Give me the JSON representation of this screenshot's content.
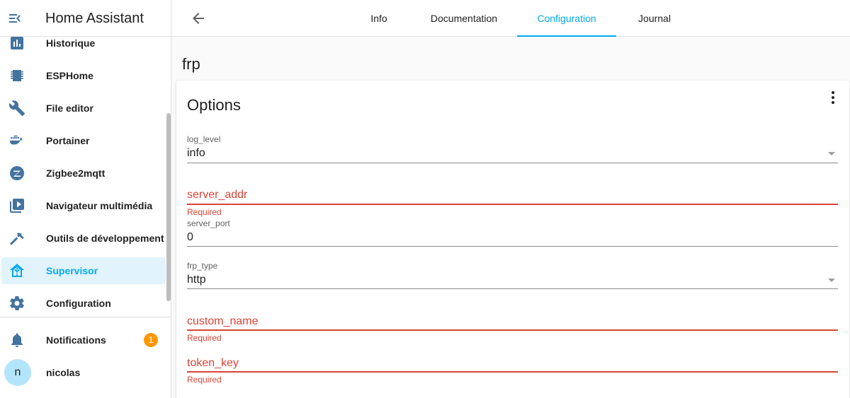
{
  "app": {
    "title": "Home Assistant"
  },
  "sidebar": {
    "items": [
      {
        "label": "Historique",
        "icon": "chart-bar-icon"
      },
      {
        "label": "ESPHome",
        "icon": "chip-icon"
      },
      {
        "label": "File editor",
        "icon": "wrench-icon"
      },
      {
        "label": "Portainer",
        "icon": "docker-icon"
      },
      {
        "label": "Zigbee2mqtt",
        "icon": "zigbee-icon"
      },
      {
        "label": "Navigateur multimédia",
        "icon": "play-box-multiple-icon"
      },
      {
        "label": "Outils de développement",
        "icon": "hammer-icon"
      },
      {
        "label": "Supervisor",
        "icon": "home-assistant-icon",
        "active": true
      },
      {
        "label": "Configuration",
        "icon": "cog-icon"
      }
    ],
    "notifications": {
      "label": "Notifications",
      "count": "1",
      "icon": "bell-icon"
    },
    "user": {
      "name": "nicolas",
      "initial": "n"
    }
  },
  "topbar": {
    "tabs": [
      {
        "label": "Info"
      },
      {
        "label": "Documentation"
      },
      {
        "label": "Configuration",
        "active": true
      },
      {
        "label": "Journal"
      }
    ]
  },
  "page": {
    "addon_name": "frp",
    "card_title": "Options",
    "fields": {
      "log_level": {
        "label": "log_level",
        "value": "info"
      },
      "server_addr": {
        "label": "server_addr",
        "helper": "Required"
      },
      "server_port": {
        "label": "server_port",
        "value": "0"
      },
      "frp_type": {
        "label": "frp_type",
        "value": "http"
      },
      "custom_name": {
        "label": "custom_name",
        "helper": "Required"
      },
      "token_key": {
        "label": "token_key",
        "helper": "Required"
      }
    }
  },
  "colors": {
    "accent": "#03a9f4",
    "active_bg": "#e1f3fc",
    "error": "#db4437",
    "badge": "#ff9800",
    "avatar": "#b3e5fc",
    "icon": "#44739e"
  }
}
